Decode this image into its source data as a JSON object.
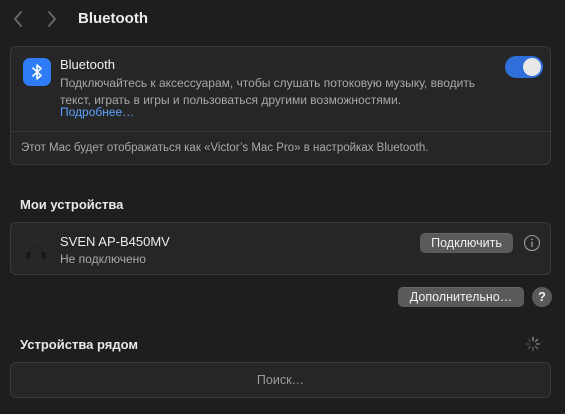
{
  "header": {
    "title": "Bluetooth",
    "back_icon": "chevron-left-icon",
    "forward_icon": "chevron-right-icon"
  },
  "bluetooth": {
    "title": "Bluetooth",
    "description": "Подключайтесь к аксессуарам, чтобы слушать потоковую музыку, вводить текст, играть в игры и пользоваться другими возможностями.",
    "more_link": "Подробнее…",
    "toggle_on": true,
    "footer": "Этот Mac будет отображаться как «Victor’s Mac Pro» в настройках Bluetooth.",
    "accent_color": "#2f7df6"
  },
  "my_devices": {
    "title": "Мои устройства",
    "devices": [
      {
        "name": "SVEN AP-B450MV",
        "status": "Не подключено",
        "icon": "headphones-icon",
        "connect_label": "Подключить"
      }
    ],
    "advanced_label": "Дополнительно…",
    "help_label": "?"
  },
  "nearby": {
    "title": "Устройства рядом",
    "search_text": "Поиск…",
    "spinner_icon": "spinner-icon"
  }
}
